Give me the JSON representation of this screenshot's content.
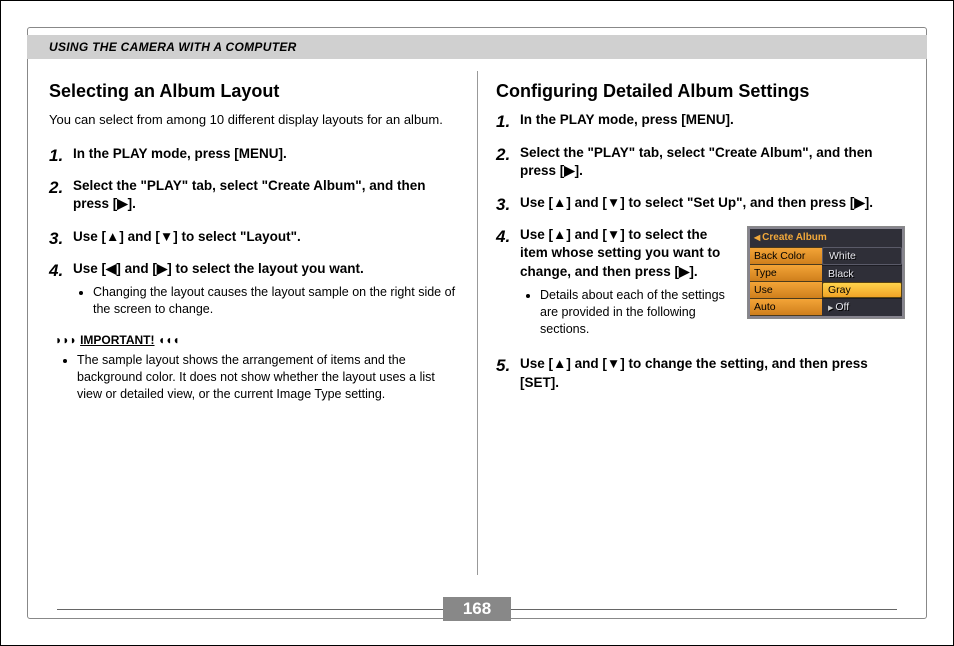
{
  "section_header": "USING THE CAMERA WITH A COMPUTER",
  "page_number": "168",
  "glyph": {
    "up": "▲",
    "down": "▼",
    "left": "◀",
    "right": "▶"
  },
  "left": {
    "title": "Selecting an Album Layout",
    "lead": "You can select from among 10 different display layouts for an album.",
    "steps": [
      {
        "text": "In the PLAY mode, press [MENU]."
      },
      {
        "text": "Select the \"PLAY\" tab, select  \"Create Album\", and then press [▶]."
      },
      {
        "text": "Use [▲] and [▼] to select \"Layout\"."
      },
      {
        "text": "Use [◀] and [▶] to select the layout you want.",
        "sub": [
          "Changing the layout causes the layout sample on the right side of the screen to change."
        ]
      }
    ],
    "important_label": "IMPORTANT!",
    "important_items": [
      "The sample layout shows the arrangement of items and the background color. It does not show whether the layout uses a list view or detailed view, or the current Image Type setting."
    ]
  },
  "right": {
    "title": "Configuring Detailed Album Settings",
    "steps": [
      {
        "text": "In the PLAY mode, press [MENU]."
      },
      {
        "text": "Select the \"PLAY\" tab, select  \"Create Album\", and then press [▶]."
      },
      {
        "text": "Use [▲] and [▼] to select \"Set Up\", and then press [▶]."
      },
      {
        "text": "Use [▲] and [▼] to select the item whose setting you want to change, and then press [▶].",
        "sub": [
          "Details about each of the settings are provided in the following sections."
        ]
      },
      {
        "text": "Use [▲] and [▼] to change the setting, and then press [SET]."
      }
    ],
    "lcd": {
      "title": "Create Album",
      "left_items": [
        "Back Color",
        "Type",
        "Use",
        "Auto"
      ],
      "right_items": [
        "White",
        "Black",
        "Gray",
        "Off"
      ],
      "right_selected_index": 2,
      "off_prefix_arrow": true
    }
  }
}
